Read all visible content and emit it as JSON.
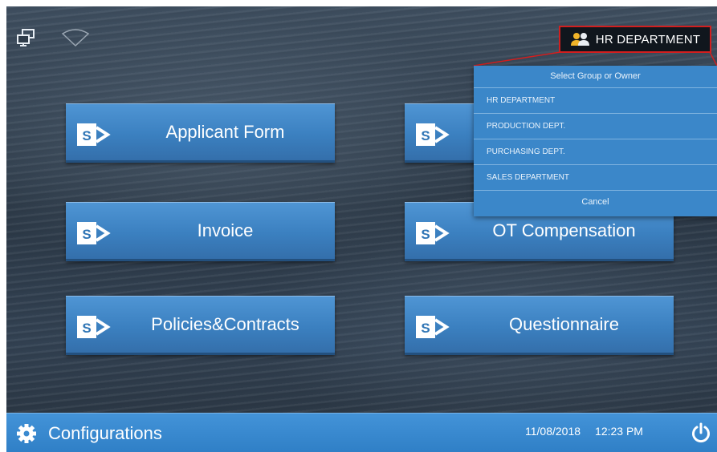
{
  "header": {
    "network_icon": "network-icon",
    "wifi_icon": "wifi-icon",
    "group_selector": {
      "label": "HR DEPARTMENT",
      "icon": "people-icon",
      "highlight_color": "#d21f1f"
    }
  },
  "dropdown": {
    "title": "Select Group or Owner",
    "items": [
      "HR DEPARTMENT",
      "PRODUCTION DEPT.",
      "PURCHASING DEPT.",
      "SALES DEPARTMENT"
    ],
    "cancel_label": "Cancel",
    "background": "#3b87c9"
  },
  "tiles": [
    {
      "label": "Applicant Form",
      "icon": "sharepoint-icon"
    },
    {
      "label": "",
      "icon": "sharepoint-icon"
    },
    {
      "label": "Invoice",
      "icon": "sharepoint-icon"
    },
    {
      "label": "OT Compensation",
      "icon": "sharepoint-icon"
    },
    {
      "label": "Policies&Contracts",
      "icon": "sharepoint-icon"
    },
    {
      "label": "Questionnaire",
      "icon": "sharepoint-icon"
    }
  ],
  "footer": {
    "config_label": "Configurations",
    "date": "11/08/2018",
    "time": "12:23 PM",
    "power_icon": "power-icon",
    "bar_color": "#3a8ad0"
  }
}
